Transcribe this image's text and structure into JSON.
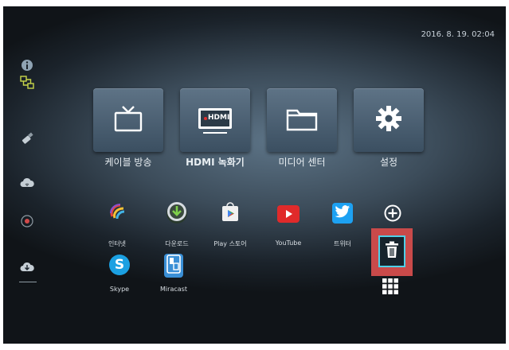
{
  "status": {
    "datetime": "2016. 8. 19. 02:04"
  },
  "sidebar": {
    "icons": [
      "info-icon",
      "network-icon",
      "usb-icon",
      "cloud-wifi-icon",
      "record-icon",
      "cloud-download-icon"
    ]
  },
  "tiles": [
    {
      "label": "케이블 방송",
      "icon": "tv-icon"
    },
    {
      "label": "HDMI 녹화기",
      "icon": "hdmi-icon",
      "badge": "HDMI"
    },
    {
      "label": "미디어 센터",
      "icon": "folder-icon"
    },
    {
      "label": "설정",
      "icon": "gear-icon"
    }
  ],
  "apps": [
    {
      "label": "인터넷",
      "icon": "internet-icon"
    },
    {
      "label": "다운로드",
      "icon": "download-icon"
    },
    {
      "label": "Play 스토어",
      "icon": "play-store-icon"
    },
    {
      "label": "YouTube",
      "icon": "youtube-icon"
    },
    {
      "label": "트위터",
      "icon": "twitter-icon"
    },
    {
      "label": "Skype",
      "icon": "skype-icon"
    },
    {
      "label": "Miracast",
      "icon": "miracast-icon"
    }
  ],
  "actions": {
    "add": "add-icon",
    "delete": "trash-icon",
    "all_apps": "apps-grid-icon"
  },
  "colors": {
    "accent": "#4ed0e8",
    "selection": "#c94a4a",
    "youtube": "#e02a2a",
    "twitter": "#1da1f2",
    "skype": "#1ba0e2"
  }
}
